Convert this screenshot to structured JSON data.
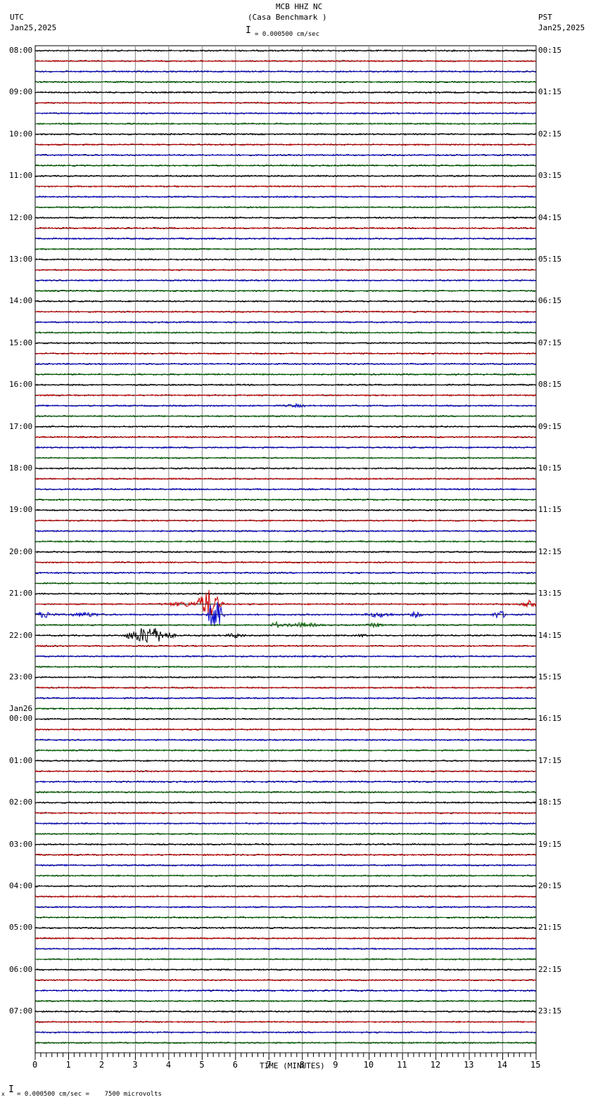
{
  "header": {
    "title": "MCB HHZ NC",
    "subtitle": "(Casa Benchmark )",
    "left_tz": "UTC",
    "left_date": "Jan25,2025",
    "right_tz": "PST",
    "right_date": "Jan25,2025",
    "scale": "= 0.000500 cm/sec"
  },
  "footer": {
    "scale": "= 0.000500 cm/sec =    7500 microvolts",
    "marker": "x"
  },
  "chart_data": {
    "type": "line",
    "title": "MCB HHZ NC (Casa Benchmark )",
    "xlabel": "TIME (MINUTES)",
    "xlim": [
      0,
      15
    ],
    "x_ticks": [
      "0",
      "1",
      "2",
      "3",
      "4",
      "5",
      "6",
      "7",
      "8",
      "9",
      "10",
      "11",
      "12",
      "13",
      "14",
      "15"
    ],
    "trace_count": 96,
    "trace_colors": [
      "#000000",
      "#cc0000",
      "#0000cc",
      "#006600"
    ],
    "left_labels": [
      "08:00",
      "09:00",
      "10:00",
      "11:00",
      "12:00",
      "13:00",
      "14:00",
      "15:00",
      "16:00",
      "17:00",
      "18:00",
      "19:00",
      "20:00",
      "21:00",
      "22:00",
      "23:00",
      "00:00",
      "01:00",
      "02:00",
      "03:00",
      "04:00",
      "05:00",
      "06:00",
      "07:00"
    ],
    "date_change_label": "Jan26",
    "date_change_hour_index": 16,
    "right_labels": [
      "00:15",
      "01:15",
      "02:15",
      "03:15",
      "04:15",
      "05:15",
      "06:15",
      "07:15",
      "08:15",
      "09:15",
      "10:15",
      "11:15",
      "12:15",
      "13:15",
      "14:15",
      "15:15",
      "16:15",
      "17:15",
      "18:15",
      "19:15",
      "20:15",
      "21:15",
      "22:15",
      "23:15"
    ],
    "events": [
      {
        "trace": 34,
        "minute": 7.8,
        "amplitude": 3,
        "duration": 0.6
      },
      {
        "trace": 53,
        "minute": 5.2,
        "amplitude": 22,
        "duration": 0.5
      },
      {
        "trace": 53,
        "minute": 4.5,
        "amplitude": 4,
        "duration": 1.2
      },
      {
        "trace": 53,
        "minute": 14.8,
        "amplitude": 6,
        "duration": 0.4
      },
      {
        "trace": 54,
        "minute": 5.4,
        "amplitude": 30,
        "duration": 0.3
      },
      {
        "trace": 54,
        "minute": 0.3,
        "amplitude": 5,
        "duration": 0.6
      },
      {
        "trace": 54,
        "minute": 1.5,
        "amplitude": 4,
        "duration": 0.8
      },
      {
        "trace": 54,
        "minute": 10.3,
        "amplitude": 4,
        "duration": 0.8
      },
      {
        "trace": 54,
        "minute": 11.4,
        "amplitude": 5,
        "duration": 0.3
      },
      {
        "trace": 54,
        "minute": 13.9,
        "amplitude": 7,
        "duration": 0.3
      },
      {
        "trace": 55,
        "minute": 8.0,
        "amplitude": 4,
        "duration": 1.0
      },
      {
        "trace": 55,
        "minute": 10.2,
        "amplitude": 4,
        "duration": 0.4
      },
      {
        "trace": 55,
        "minute": 7.2,
        "amplitude": 6,
        "duration": 0.2
      },
      {
        "trace": 56,
        "minute": 3.4,
        "amplitude": 14,
        "duration": 0.9
      },
      {
        "trace": 56,
        "minute": 4.1,
        "amplitude": 4,
        "duration": 0.2
      },
      {
        "trace": 56,
        "minute": 6.0,
        "amplitude": 4,
        "duration": 0.5
      },
      {
        "trace": 56,
        "minute": 9.8,
        "amplitude": 4,
        "duration": 0.2
      },
      {
        "trace": 57,
        "minute": 0.5,
        "amplitude": 2,
        "duration": 1.0
      }
    ]
  }
}
